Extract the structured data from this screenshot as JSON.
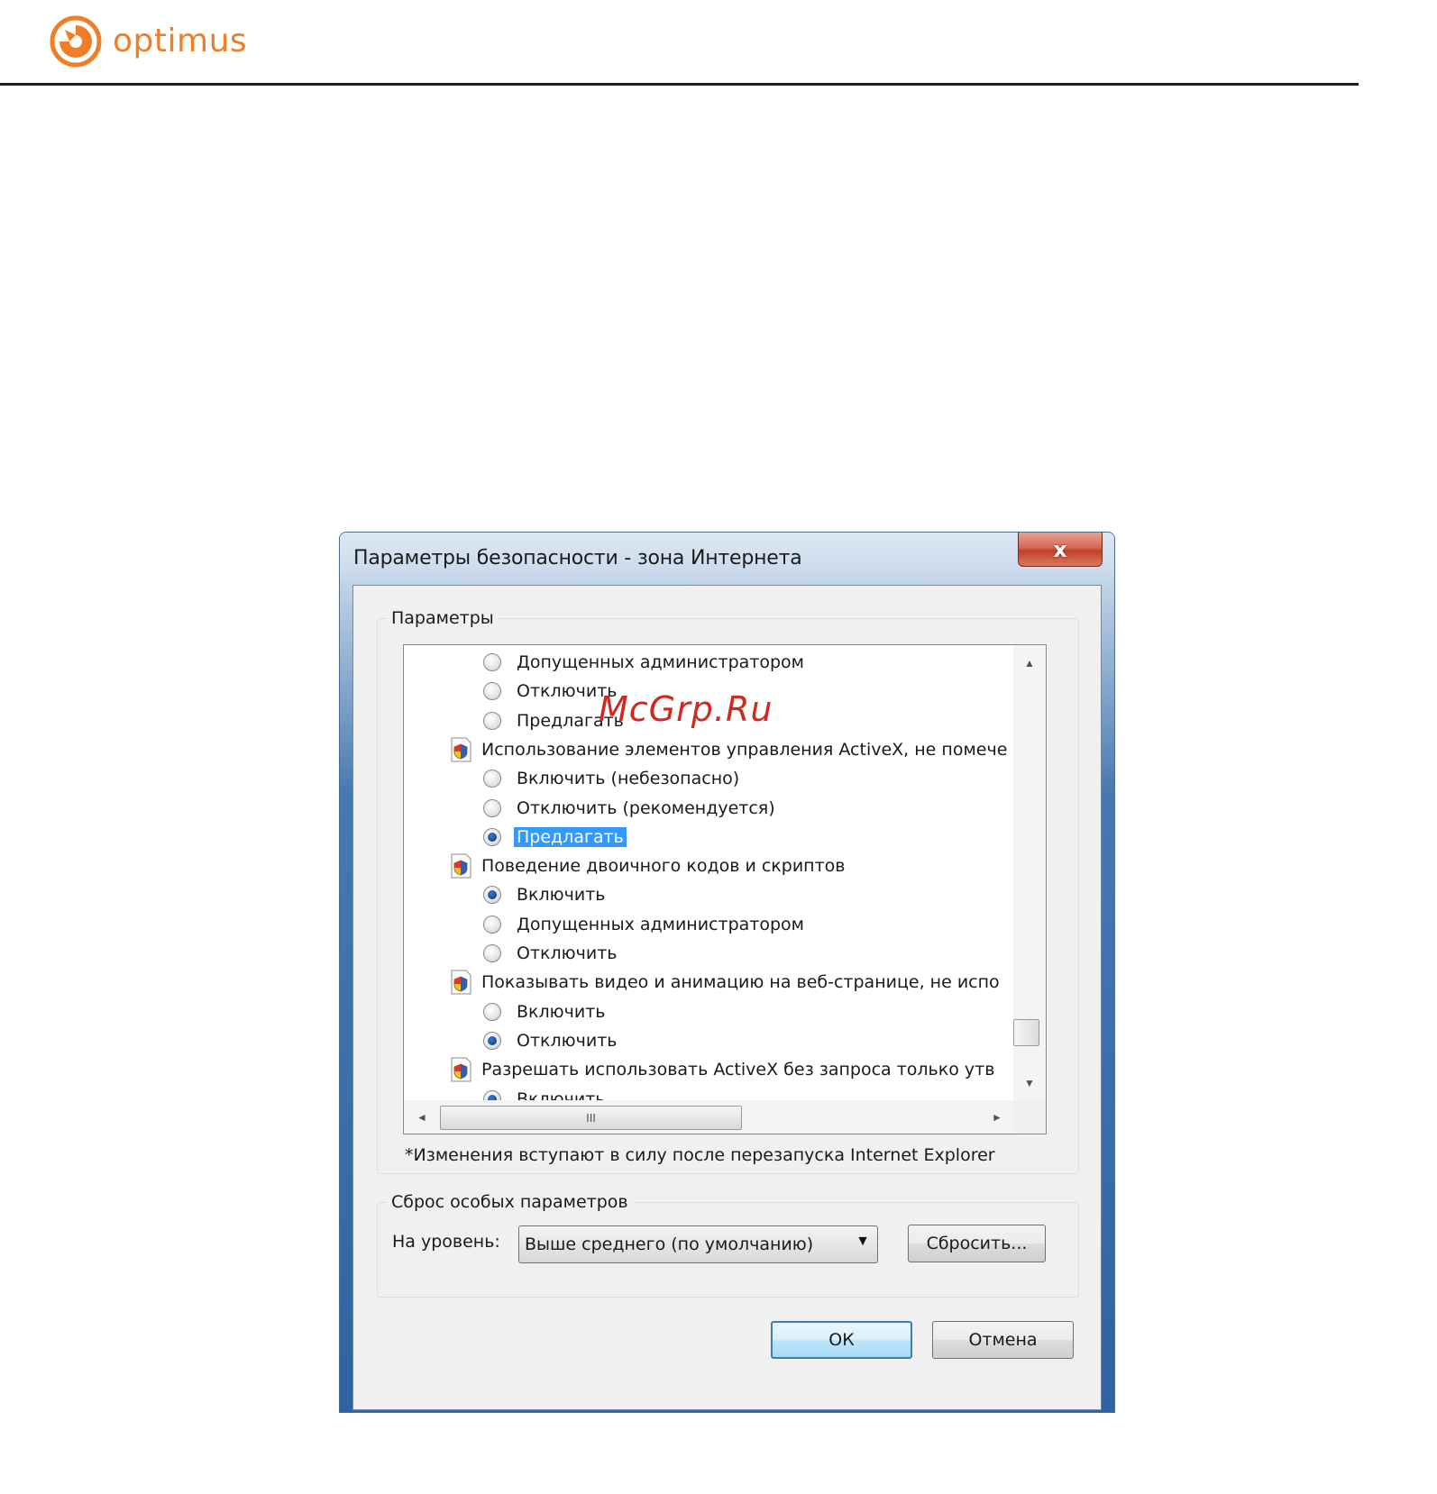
{
  "brand": {
    "logo_text": "optimus",
    "accent_color": "#f07e26"
  },
  "dialog": {
    "title": "Параметры безопасности - зона Интернета",
    "close_label": "x",
    "settings_group": {
      "legend": "Параметры",
      "rows": [
        {
          "type": "option",
          "label": "Допущенных администратором",
          "checked": false
        },
        {
          "type": "option",
          "label": "Отключить",
          "checked": false
        },
        {
          "type": "option",
          "label": "Предлагать",
          "checked": false
        },
        {
          "type": "category",
          "label": "Использование элементов управления ActiveX, не помече"
        },
        {
          "type": "option",
          "label": "Включить (небезопасно)",
          "checked": false
        },
        {
          "type": "option",
          "label": "Отключить (рекомендуется)",
          "checked": false
        },
        {
          "type": "option",
          "label": "Предлагать",
          "checked": true,
          "selected": true
        },
        {
          "type": "category",
          "label": "Поведение двоичного кодов и скриптов"
        },
        {
          "type": "option",
          "label": "Включить",
          "checked": true
        },
        {
          "type": "option",
          "label": "Допущенных администратором",
          "checked": false
        },
        {
          "type": "option",
          "label": "Отключить",
          "checked": false
        },
        {
          "type": "category",
          "label": "Показывать видео и анимацию на веб-странице, не испо"
        },
        {
          "type": "option",
          "label": "Включить",
          "checked": false
        },
        {
          "type": "option",
          "label": "Отключить",
          "checked": true
        },
        {
          "type": "category",
          "label": "Разрешать использовать ActiveX без запроса только утв"
        },
        {
          "type": "option",
          "label": "Включить",
          "checked": true
        }
      ],
      "hscroll_grip": "III",
      "note": "*Изменения вступают в силу после перезапуска Internet Explorer"
    },
    "reset_group": {
      "legend": "Сброс особых параметров",
      "level_label": "На уровень:",
      "level_value": "Выше среднего (по умолчанию)",
      "reset_button": "Сбросить..."
    },
    "ok_button": "ОК",
    "cancel_button": "Отмена"
  },
  "watermark": "McGrp.Ru"
}
